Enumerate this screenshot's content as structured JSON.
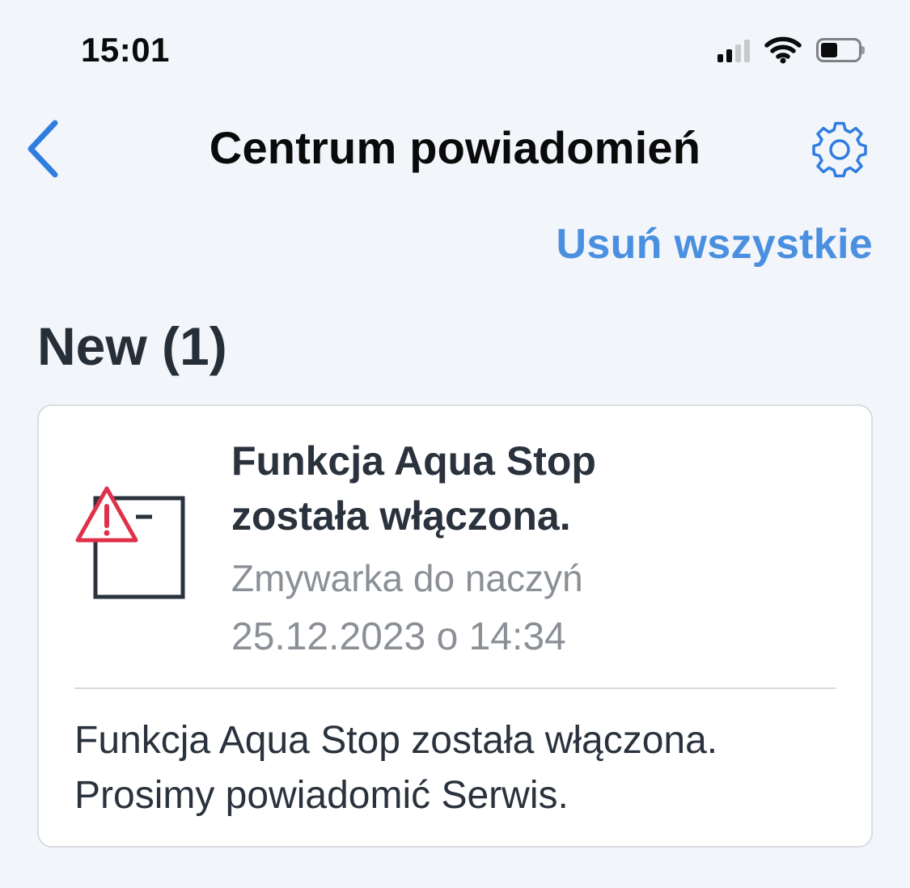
{
  "status_bar": {
    "time": "15:01",
    "icons": [
      "cellular-signal-icon",
      "wifi-icon",
      "battery-icon"
    ]
  },
  "nav": {
    "back_icon": "chevron-left-icon",
    "title": "Centrum powiadomień",
    "settings_icon": "gear-icon"
  },
  "actions": {
    "delete_all_label": "Usuń wszystkie"
  },
  "section": {
    "title": "New (1)"
  },
  "notifications": [
    {
      "icon": "dishwasher-warning-icon",
      "title": "Funkcja Aqua Stop została włączona.",
      "device": "Zmywarka do naczyń",
      "datetime": "25.12.2023 o 14:34",
      "message": "Funkcja Aqua Stop została włączona. Prosimy powiadomić Serwis."
    }
  ],
  "colors": {
    "background": "#f2f5f9",
    "accent": "#4a8fe0",
    "nav_accent": "#2f7de0",
    "warning": "#e0304a",
    "text_primary": "#2a323d",
    "text_secondary": "#8b9097"
  }
}
